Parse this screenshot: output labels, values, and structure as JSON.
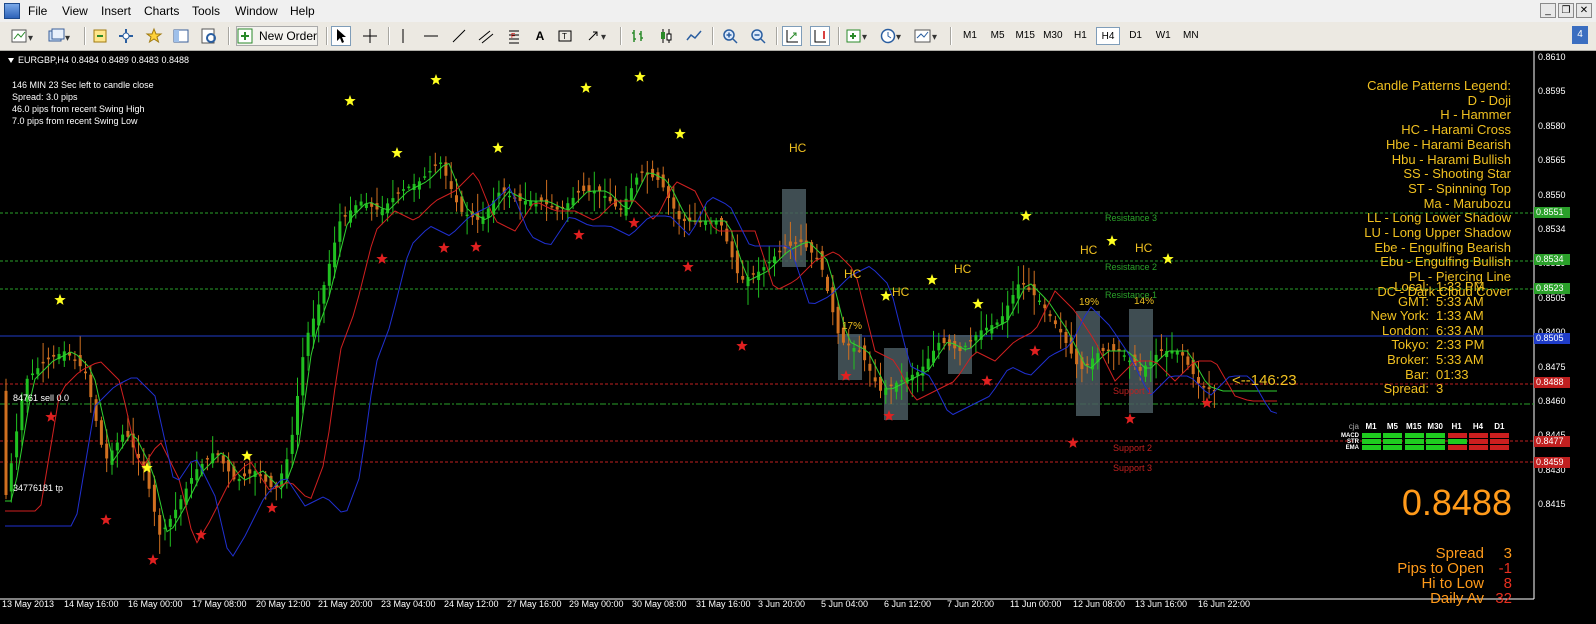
{
  "menu": {
    "file": "File",
    "view": "View",
    "insert": "Insert",
    "charts": "Charts",
    "tools": "Tools",
    "window": "Window",
    "help": "Help"
  },
  "toolbar": {
    "new_order": "New Order",
    "timeframes": [
      "M1",
      "M5",
      "M15",
      "M30",
      "H1",
      "H4",
      "D1",
      "W1",
      "MN"
    ],
    "active_timeframe": "H4",
    "window_count": "4"
  },
  "chart": {
    "symbol_line": "EURGBP,H4  0.8484 0.8489 0.8483 0.8488",
    "info": {
      "candle_close": "146 MIN 23 Sec left to candle close",
      "spread": "Spread: 3.0 pips",
      "swing_high": "46.0 pips from recent Swing High",
      "swing_low": "7.0 pips from recent Swing Low"
    },
    "trade_sell": "84761 sell 0.0",
    "trade_tp": "34776181 tp",
    "candle_timer": "<--146:23",
    "legend": [
      "Candle Patterns Legend:",
      "D - Doji",
      "H - Hammer",
      "HC - Harami Cross",
      "Hbe - Harami Bearish",
      "Hbu - Harami Bullish",
      "SS - Shooting Star",
      "ST - Spinning Top",
      "Ma - Marubozu",
      "LL - Long Lower Shadow",
      "LU - Long Upper Shadow",
      "Ebe - Engulfing Bearish",
      "Ebu - Engulfing Bullish",
      "PL - Piercing Line",
      "DC - Dark Cloud Cover"
    ],
    "clock": [
      {
        "label": "Local:",
        "value": "1:33 PM"
      },
      {
        "label": "GMT:",
        "value": "5:33 AM"
      },
      {
        "label": "New York:",
        "value": "1:33 AM"
      },
      {
        "label": "London:",
        "value": "6:33 AM"
      },
      {
        "label": "Tokyo:",
        "value": "2:33 PM"
      },
      {
        "label": "Broker:",
        "value": "5:33 AM"
      },
      {
        "label": "Bar:",
        "value": "01:33"
      },
      {
        "label": "Spread:",
        "value": "3"
      }
    ],
    "pattern_labels": [
      "HC",
      "HC",
      "HC",
      "HC",
      "HC",
      "HC",
      "HC"
    ],
    "percent_labels": [
      "17%",
      "19%",
      "14%"
    ],
    "levels": {
      "resistance3": "Resistance 3",
      "resistance2": "Resistance 2",
      "resistance1": "Resistance 1",
      "support1": "Support 1",
      "support2": "Support 2",
      "support3": "Support 3"
    },
    "y_axis": [
      "0.8610",
      "0.8595",
      "0.8580",
      "0.8565",
      "0.8550",
      "0.8534",
      "0.8519",
      "0.8505",
      "0.8490",
      "0.8475",
      "0.8460",
      "0.8445",
      "0.8430",
      "0.8415"
    ],
    "price_tags": [
      {
        "value": "0.8551",
        "color": "#2aa02a"
      },
      {
        "value": "0.8534",
        "color": "#2aa02a"
      },
      {
        "value": "0.8523",
        "color": "#2aa02a"
      },
      {
        "value": "0.8505",
        "color": "#1f3cc8"
      },
      {
        "value": "0.8488",
        "color": "#c02020"
      },
      {
        "value": "0.8477",
        "color": "#c02020"
      },
      {
        "value": "0.8459",
        "color": "#c02020"
      }
    ],
    "x_axis": [
      "13 May 2013",
      "14 May 16:00",
      "16 May 00:00",
      "17 May 08:00",
      "20 May 12:00",
      "21 May 20:00",
      "23 May 04:00",
      "24 May 12:00",
      "27 May 16:00",
      "29 May 00:00",
      "30 May 08:00",
      "31 May 16:00",
      "3 Jun 20:00",
      "5 Jun 04:00",
      "6 Jun 12:00",
      "7 Jun 20:00",
      "11 Jun 00:00",
      "12 Jun 08:00",
      "13 Jun 16:00",
      "16 Jun 22:00"
    ]
  },
  "signals": {
    "headers": [
      "M1",
      "M5",
      "M15",
      "M30",
      "H1",
      "H4",
      "D1"
    ],
    "corner": "cja",
    "rows": [
      {
        "name": "MACD",
        "colors": [
          "#1fcc1f",
          "#1fcc1f",
          "#1fcc1f",
          "#1fcc1f",
          "#cc1f1f",
          "#cc1f1f",
          "#cc1f1f"
        ]
      },
      {
        "name": "STR",
        "colors": [
          "#1fcc1f",
          "#1fcc1f",
          "#1fcc1f",
          "#1fcc1f",
          "#1fcc1f",
          "#cc1f1f",
          "#cc1f1f"
        ]
      },
      {
        "name": "EMA",
        "colors": [
          "#1fcc1f",
          "#1fcc1f",
          "#1fcc1f",
          "#1fcc1f",
          "#cc1f1f",
          "#cc1f1f",
          "#cc1f1f"
        ]
      }
    ]
  },
  "stats": {
    "price": "0.8488",
    "rows": [
      {
        "label": "Spread",
        "value": "3"
      },
      {
        "label": "Pips to Open",
        "value": "-1"
      },
      {
        "label": "Hi to Low",
        "value": "8"
      },
      {
        "label": "Daily Av",
        "value": "32"
      }
    ]
  }
}
